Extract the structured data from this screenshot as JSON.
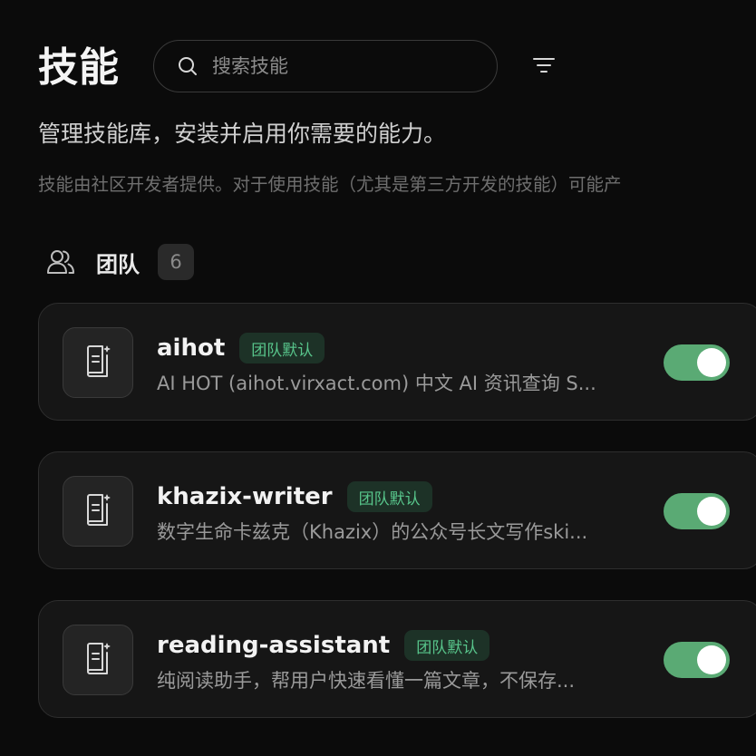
{
  "header": {
    "title": "技能",
    "search_placeholder": "搜索技能",
    "subtitle": "管理技能库，安装并启用你需要的能力。",
    "disclaimer": "技能由社区开发者提供。对于使用技能（尤其是第三方开发的技能）可能产"
  },
  "section": {
    "label": "团队",
    "count": "6"
  },
  "skills": [
    {
      "name": "aihot",
      "badge": "团队默认",
      "description": "AI HOT (aihot.virxact.com) 中文 AI 资讯查询 S...",
      "enabled": true
    },
    {
      "name": "khazix-writer",
      "badge": "团队默认",
      "description": "数字生命卡兹克（Khazix）的公众号长文写作ski...",
      "enabled": true
    },
    {
      "name": "reading-assistant",
      "badge": "团队默认",
      "description": "纯阅读助手，帮用户快速看懂一篇文章，不保存...",
      "enabled": true
    }
  ],
  "icons": {
    "search": "search-icon",
    "filter": "filter-icon",
    "team": "team-icon",
    "skill": "book-icon"
  },
  "colors": {
    "background": "#0b0b0b",
    "card": "#161616",
    "toggle_on": "#5aaa74",
    "badge_text": "#58c58b",
    "badge_bg": "#1d3227"
  }
}
